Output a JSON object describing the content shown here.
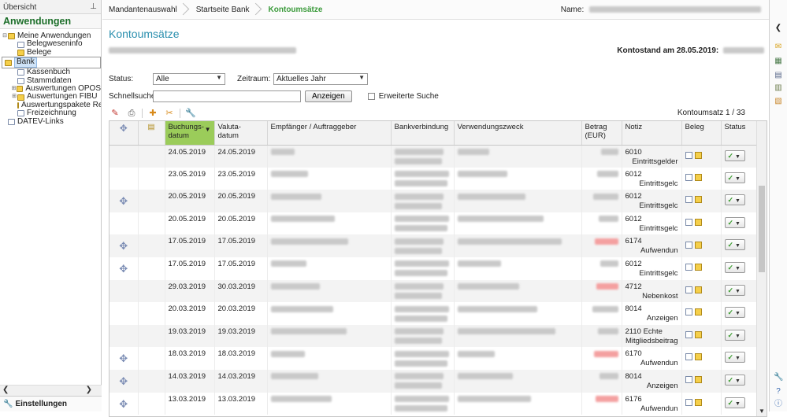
{
  "sidebar": {
    "header": "Übersicht",
    "title": "Anwendungen",
    "tree": [
      {
        "label": "Meine Anwendungen",
        "level": 1,
        "toggle": "⊟",
        "icon": "folder"
      },
      {
        "label": "Belegweseninfo",
        "level": 2,
        "icon": "doc"
      },
      {
        "label": "Belege",
        "level": 2,
        "icon": "folder"
      },
      {
        "label": "Bank",
        "level": 2,
        "icon": "folder",
        "selected": true
      },
      {
        "label": "Kassenbuch",
        "level": 2,
        "icon": "doc"
      },
      {
        "label": "Stammdaten",
        "level": 2,
        "icon": "doc"
      },
      {
        "label": "Auswertungen OPOS",
        "level": "2b",
        "toggle": "⊞",
        "icon": "folder"
      },
      {
        "label": "Auswertungen FIBU",
        "level": "2b",
        "toggle": "⊞",
        "icon": "folder"
      },
      {
        "label": "Auswertungspakete Rechnu",
        "level": 2,
        "icon": "folder"
      },
      {
        "label": "Freizeichnung",
        "level": 2,
        "icon": "doc"
      },
      {
        "label": "DATEV-Links",
        "level": 1,
        "toggle": "",
        "icon": "doc"
      }
    ],
    "footer": "Einstellungen"
  },
  "breadcrumb": {
    "items": [
      "Mandantenauswahl",
      "Startseite Bank",
      "Kontoumsätze"
    ]
  },
  "name_label": "Name:",
  "page": {
    "title": "Kontoumsätze",
    "kontostand_label": "Kontostand am 28.05.2019:"
  },
  "filters": {
    "status_label": "Status:",
    "status_value": "Alle",
    "zeitraum_label": "Zeitraum:",
    "zeitraum_value": "Aktuelles Jahr",
    "search_label": "Schnellsuche:",
    "search_button": "Anzeigen",
    "advanced_label": "Erweiterte Suche"
  },
  "toolbar": {
    "count": "Kontoumsatz 1 / 33"
  },
  "table": {
    "headers": [
      "",
      "",
      "Buchungs-\ndatum",
      "Valuta-\ndatum",
      "Empfänger / Auftraggeber",
      "Bankverbindung",
      "Verwendungszweck",
      "Betrag\n(EUR)",
      "Notiz",
      "Beleg",
      "Status"
    ],
    "rows": [
      {
        "split": false,
        "buchung": "24.05.2019",
        "valuta": "24.05.2019",
        "betrag_neg": false,
        "notiz1": "6010",
        "notiz2": "Eintrittsgelder"
      },
      {
        "split": false,
        "buchung": "23.05.2019",
        "valuta": "23.05.2019",
        "betrag_neg": false,
        "notiz1": "6012",
        "notiz2": "Eintrittsgelc"
      },
      {
        "split": true,
        "buchung": "20.05.2019",
        "valuta": "20.05.2019",
        "betrag_neg": false,
        "notiz1": "6012",
        "notiz2": "Eintrittsgelc"
      },
      {
        "split": false,
        "buchung": "20.05.2019",
        "valuta": "20.05.2019",
        "betrag_neg": false,
        "notiz1": "6012",
        "notiz2": "Eintrittsgelc"
      },
      {
        "split": true,
        "buchung": "17.05.2019",
        "valuta": "17.05.2019",
        "betrag_neg": true,
        "notiz1": "6174",
        "notiz2": "Aufwendun"
      },
      {
        "split": true,
        "buchung": "17.05.2019",
        "valuta": "17.05.2019",
        "betrag_neg": false,
        "notiz1": "6012",
        "notiz2": "Eintrittsgelc"
      },
      {
        "split": false,
        "buchung": "29.03.2019",
        "valuta": "30.03.2019",
        "betrag_neg": true,
        "notiz1": "4712",
        "notiz2": "Nebenkost"
      },
      {
        "split": false,
        "buchung": "20.03.2019",
        "valuta": "20.03.2019",
        "betrag_neg": false,
        "notiz1": "8014",
        "notiz2": "Anzeigen"
      },
      {
        "split": false,
        "buchung": "19.03.2019",
        "valuta": "19.03.2019",
        "betrag_neg": false,
        "notiz1": "2110 Echte",
        "notiz2": "Mitgliedsbeitrag"
      },
      {
        "split": true,
        "buchung": "18.03.2019",
        "valuta": "18.03.2019",
        "betrag_neg": true,
        "notiz1": "6170",
        "notiz2": "Aufwendun"
      },
      {
        "split": true,
        "buchung": "14.03.2019",
        "valuta": "14.03.2019",
        "betrag_neg": false,
        "notiz1": "8014",
        "notiz2": "Anzeigen"
      },
      {
        "split": true,
        "buchung": "13.03.2019",
        "valuta": "13.03.2019",
        "betrag_neg": true,
        "notiz1": "6176",
        "notiz2": "Aufwendun"
      }
    ]
  },
  "colors": {
    "accent_green": "#3a9a3a",
    "title_blue": "#2a8fae",
    "sorted_header": "#9bcc5a",
    "negative_red": "#e05a5a"
  }
}
